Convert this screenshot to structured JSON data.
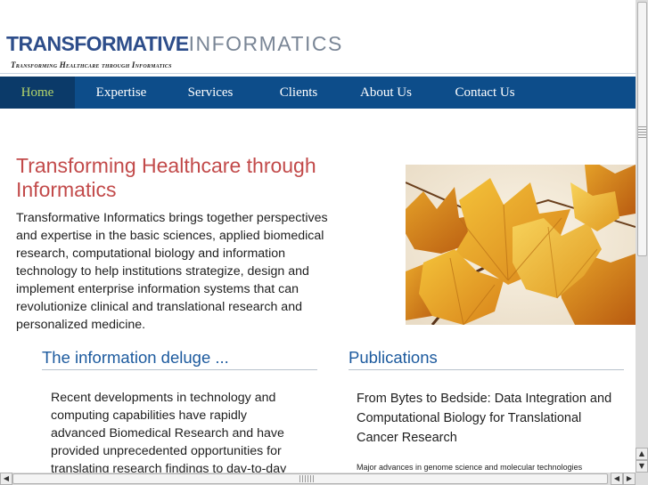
{
  "header": {
    "logo_part1": "TRANSFORMATIVE",
    "logo_part2": "INFORMATICS",
    "tagline": "Transforming Healthcare through Informatics"
  },
  "nav": {
    "items": [
      {
        "label": "Home",
        "active": true
      },
      {
        "label": "Expertise"
      },
      {
        "label": "Services"
      },
      {
        "label": "Clients"
      },
      {
        "label": "About Us"
      },
      {
        "label": "Contact Us"
      }
    ]
  },
  "intro": {
    "title": "Transforming Healthcare through Informatics",
    "body": "Transformative Informatics brings together perspectives and expertise in the basic sciences, applied biomedical research, computational biology and information technology to help institutions strategize, design and implement enterprise information systems that can revolutionize clinical and translational research and personalized medicine."
  },
  "left_column": {
    "heading": "The information deluge ...",
    "body": "Recent developments in technology and computing capabilities have rapidly advanced Biomedical Research and have provided unprecedented opportunities for translating research findings to day-to-day"
  },
  "right_column": {
    "heading": "Publications",
    "pub_title": "From Bytes to Bedside: Data Integration and Computational Biology for Translational Cancer Research",
    "pub_summary": "Major advances in genome science and molecular technologies"
  },
  "colors": {
    "logo_blue": "#2d4d8a",
    "logo_gray": "#7a8696",
    "nav_bg": "#0d4d8a",
    "nav_active_bg": "#0b3a69",
    "nav_active_text": "#b5d66b",
    "intro_title": "#c24a4a",
    "section_heading": "#1c5a9e"
  },
  "icons": {
    "scroll_up": "arrow-up-icon",
    "scroll_down": "arrow-down-icon",
    "scroll_left": "arrow-left-icon",
    "scroll_right": "arrow-right-icon"
  }
}
